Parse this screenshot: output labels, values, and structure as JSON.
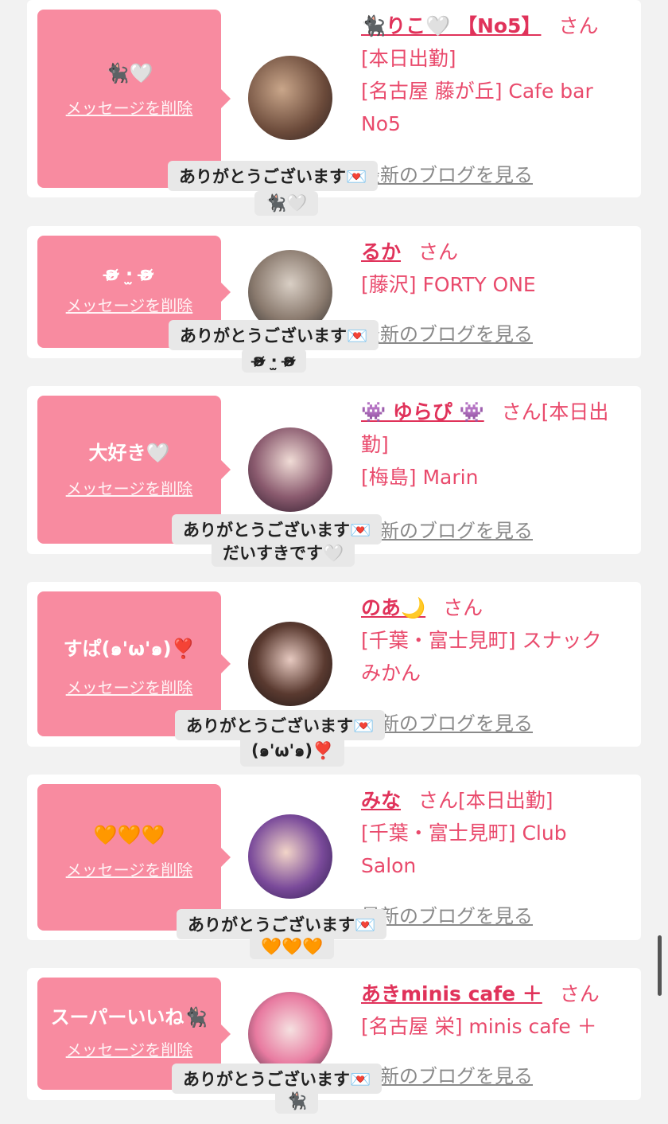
{
  "items": [
    {
      "message": "🐈‍⬛🤍",
      "delete_label": "メッセージを削除",
      "name": "🐈‍⬛りこ🤍 【No5】",
      "san": "さん",
      "line1": "[本日出勤]",
      "line2": "[名古屋 藤が丘] Cafe bar",
      "line3": "No5",
      "blog": "最新のブログを見る",
      "thanks": "ありがとうございます💌",
      "thanks_sub": "🐈‍⬛🤍"
    },
    {
      "message": "ʚ̴̶̷̷ ·̫ ʚ̴̶̷̷",
      "delete_label": "メッセージを削除",
      "name": "るか",
      "san": "さん",
      "line1": "[藤沢] FORTY ONE",
      "blog": "最新のブログを見る",
      "thanks": "ありがとうございます💌",
      "thanks_sub": "ʚ̴̶̷̷ ·̫ ʚ̴̶̷̷"
    },
    {
      "message": "大好き🤍",
      "delete_label": "メッセージを削除",
      "name": "👾 ゆらぴ 👾",
      "san": "さん[本日出",
      "line1": "勤]",
      "line2": "[梅島] Marin",
      "blog": "最新のブログを見る",
      "thanks": "ありがとうございます💌",
      "thanks_sub": "だいすきです🤍"
    },
    {
      "message": "すぱ(๑'ω'๑)❣️",
      "delete_label": "メッセージを削除",
      "name": "のあ🌙",
      "san": "さん",
      "line1": "[千葉・富士見町] スナック",
      "line2": "みかん",
      "blog": "最新のブログを見る",
      "thanks": "ありがとうございます💌",
      "thanks_sub": "(๑'ω'๑)❣️"
    },
    {
      "message": "🧡🧡🧡",
      "delete_label": "メッセージを削除",
      "name": "みな",
      "san": "さん[本日出勤]",
      "line1": "[千葉・富士見町] Club",
      "line2": "Salon",
      "blog": "最新のブログを見る",
      "thanks": "ありがとうございます💌",
      "thanks_sub": "🧡🧡🧡"
    },
    {
      "message": "スーパーいいね🐈‍⬛",
      "delete_label": "メッセージを削除",
      "name": "あきminis cafe ＋",
      "san": "さん",
      "line1": "[名古屋 栄] minis cafe ＋",
      "blog": "最新のブログを見る",
      "thanks": "ありがとうございます💌",
      "thanks_sub": "🐈‍⬛"
    }
  ],
  "colors": {
    "accent": "#e0325a",
    "bubble": "#f88ba0",
    "background": "#f2f2f2"
  }
}
